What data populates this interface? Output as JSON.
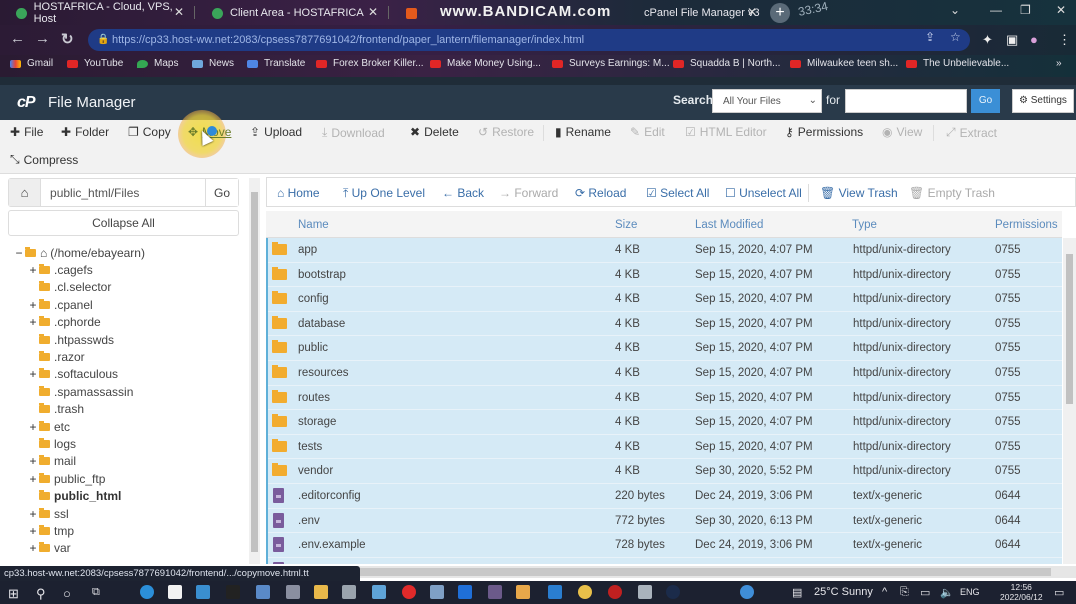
{
  "browser": {
    "tabs": [
      {
        "title": "HOSTAFRICA - Cloud, VPS, Host",
        "favicon": "hostafrica-icon"
      },
      {
        "title": "Client Area - HOSTAFRICA",
        "favicon": "hostafrica-icon"
      },
      {
        "title": "cPanel File Manager v3",
        "favicon": "cpanel-icon"
      }
    ],
    "watermark": "www.BANDICAM.com",
    "overlay_time": "33:34",
    "url_host": "https://cp33.host-ww.net",
    "url_path": ":2083/cpsess7877691042/frontend/paper_lantern/filemanager/index.html",
    "bookmarks": [
      {
        "label": "Gmail",
        "icon": "gmail-icon"
      },
      {
        "label": "YouTube",
        "icon": "youtube-icon"
      },
      {
        "label": "Maps",
        "icon": "maps-icon"
      },
      {
        "label": "News",
        "icon": "news-icon"
      },
      {
        "label": "Translate",
        "icon": "translate-icon"
      },
      {
        "label": "Forex Broker Killer...",
        "icon": "youtube-icon"
      },
      {
        "label": "Make Money Using...",
        "icon": "youtube-icon"
      },
      {
        "label": "Surveys Earnings: M...",
        "icon": "youtube-icon"
      },
      {
        "label": "Squadda B | North...",
        "icon": "youtube-icon"
      },
      {
        "label": "Milwaukee teen sh...",
        "icon": "youtube-icon"
      },
      {
        "label": "The Unbelievable...",
        "icon": "youtube-icon"
      }
    ],
    "more_bookmarks": "»"
  },
  "header": {
    "title": "File Manager",
    "search_label": "Search",
    "search_scope": "All Your Files",
    "for_label": "for",
    "search_value": "",
    "go_label": "Go",
    "settings_label": "Settings"
  },
  "toolbar": [
    {
      "label": "File",
      "icon": "plus-icon",
      "enabled": true
    },
    {
      "label": "Folder",
      "icon": "plus-icon",
      "enabled": true
    },
    {
      "label": "Copy",
      "icon": "copy-icon",
      "enabled": true
    },
    {
      "label": "Move",
      "icon": "move-icon",
      "enabled": true
    },
    {
      "label": "Upload",
      "icon": "upload-icon",
      "enabled": true
    },
    {
      "label": "Download",
      "icon": "download-icon",
      "enabled": false
    },
    {
      "label": "Delete",
      "icon": "delete-icon",
      "enabled": true
    },
    {
      "label": "Restore",
      "icon": "restore-icon",
      "enabled": false
    },
    {
      "label": "Rename",
      "icon": "rename-icon",
      "enabled": true
    },
    {
      "label": "Edit",
      "icon": "pencil-icon",
      "enabled": false
    },
    {
      "label": "HTML Editor",
      "icon": "html-editor-icon",
      "enabled": false
    },
    {
      "label": "Permissions",
      "icon": "key-icon",
      "enabled": true
    },
    {
      "label": "View",
      "icon": "eye-icon",
      "enabled": false
    },
    {
      "label": "Extract",
      "icon": "extract-icon",
      "enabled": false
    },
    {
      "label": "Compress",
      "icon": "compress-icon",
      "enabled": true
    }
  ],
  "sidebar": {
    "path_value": "public_html/Files",
    "go_label": "Go",
    "collapse_label": "Collapse All",
    "root": "(/home/ebayearn)",
    "tree": [
      {
        "name": ".cagefs",
        "expandable": true
      },
      {
        "name": ".cl.selector",
        "expandable": false
      },
      {
        "name": ".cpanel",
        "expandable": true
      },
      {
        "name": ".cphorde",
        "expandable": true
      },
      {
        "name": ".htpasswds",
        "expandable": false
      },
      {
        "name": ".razor",
        "expandable": false
      },
      {
        "name": ".softaculous",
        "expandable": true
      },
      {
        "name": ".spamassassin",
        "expandable": false
      },
      {
        "name": ".trash",
        "expandable": false
      },
      {
        "name": "etc",
        "expandable": true
      },
      {
        "name": "logs",
        "expandable": false
      },
      {
        "name": "mail",
        "expandable": true
      },
      {
        "name": "public_ftp",
        "expandable": true
      },
      {
        "name": "public_html",
        "expandable": false,
        "selected": true
      },
      {
        "name": "ssl",
        "expandable": true
      },
      {
        "name": "tmp",
        "expandable": true
      },
      {
        "name": "var",
        "expandable": true
      }
    ]
  },
  "nav": [
    {
      "label": "Home",
      "icon": "home-icon",
      "enabled": true
    },
    {
      "label": "Up One Level",
      "icon": "up-level-icon",
      "enabled": true
    },
    {
      "label": "Back",
      "icon": "back-arrow-icon",
      "enabled": true
    },
    {
      "label": "Forward",
      "icon": "forward-arrow-icon",
      "enabled": false
    },
    {
      "label": "Reload",
      "icon": "reload-icon",
      "enabled": true
    },
    {
      "label": "Select All",
      "icon": "checkbox-checked-icon",
      "enabled": true
    },
    {
      "label": "Unselect All",
      "icon": "checkbox-empty-icon",
      "enabled": true
    },
    {
      "label": "View Trash",
      "icon": "trash-icon",
      "enabled": true
    },
    {
      "label": "Empty Trash",
      "icon": "trash-icon",
      "enabled": false
    }
  ],
  "table": {
    "columns": [
      "Name",
      "Size",
      "Last Modified",
      "Type",
      "Permissions"
    ],
    "rows": [
      {
        "kind": "folder",
        "name": "app",
        "size": "4 KB",
        "modified": "Sep 15, 2020, 4:07 PM",
        "type": "httpd/unix-directory",
        "perms": "0755"
      },
      {
        "kind": "folder",
        "name": "bootstrap",
        "size": "4 KB",
        "modified": "Sep 15, 2020, 4:07 PM",
        "type": "httpd/unix-directory",
        "perms": "0755"
      },
      {
        "kind": "folder",
        "name": "config",
        "size": "4 KB",
        "modified": "Sep 15, 2020, 4:07 PM",
        "type": "httpd/unix-directory",
        "perms": "0755"
      },
      {
        "kind": "folder",
        "name": "database",
        "size": "4 KB",
        "modified": "Sep 15, 2020, 4:07 PM",
        "type": "httpd/unix-directory",
        "perms": "0755"
      },
      {
        "kind": "folder",
        "name": "public",
        "size": "4 KB",
        "modified": "Sep 15, 2020, 4:07 PM",
        "type": "httpd/unix-directory",
        "perms": "0755"
      },
      {
        "kind": "folder",
        "name": "resources",
        "size": "4 KB",
        "modified": "Sep 15, 2020, 4:07 PM",
        "type": "httpd/unix-directory",
        "perms": "0755"
      },
      {
        "kind": "folder",
        "name": "routes",
        "size": "4 KB",
        "modified": "Sep 15, 2020, 4:07 PM",
        "type": "httpd/unix-directory",
        "perms": "0755"
      },
      {
        "kind": "folder",
        "name": "storage",
        "size": "4 KB",
        "modified": "Sep 15, 2020, 4:07 PM",
        "type": "httpd/unix-directory",
        "perms": "0755"
      },
      {
        "kind": "folder",
        "name": "tests",
        "size": "4 KB",
        "modified": "Sep 15, 2020, 4:07 PM",
        "type": "httpd/unix-directory",
        "perms": "0755"
      },
      {
        "kind": "folder",
        "name": "vendor",
        "size": "4 KB",
        "modified": "Sep 30, 2020, 5:52 PM",
        "type": "httpd/unix-directory",
        "perms": "0755"
      },
      {
        "kind": "file",
        "name": ".editorconfig",
        "size": "220 bytes",
        "modified": "Dec 24, 2019, 3:06 PM",
        "type": "text/x-generic",
        "perms": "0644"
      },
      {
        "kind": "file",
        "name": ".env",
        "size": "772 bytes",
        "modified": "Sep 30, 2020, 6:13 PM",
        "type": "text/x-generic",
        "perms": "0644"
      },
      {
        "kind": "file",
        "name": ".env.example",
        "size": "728 bytes",
        "modified": "Dec 24, 2019, 3:06 PM",
        "type": "text/x-generic",
        "perms": "0644"
      },
      {
        "kind": "file",
        "name": "",
        "size": "",
        "modified": "",
        "type": "",
        "perms": ""
      }
    ]
  },
  "status_url": "cp33.host-ww.net:2083/cpsess7877691042/frontend/.../copymove.html.tt",
  "taskbar": {
    "weather": "25°C  Sunny",
    "language": "ENG",
    "time": "12:56",
    "date": "2022/06/12"
  }
}
